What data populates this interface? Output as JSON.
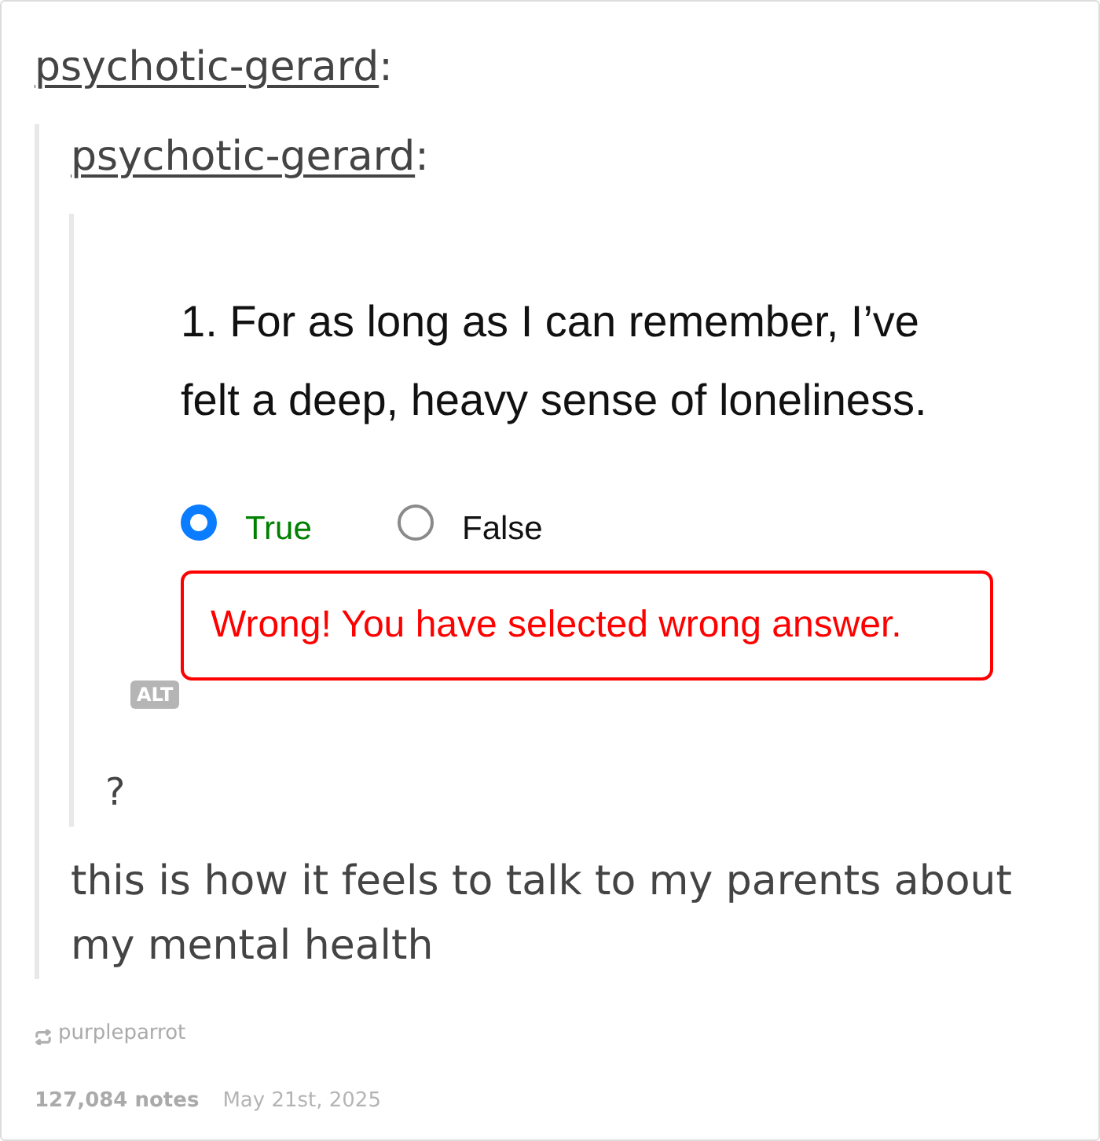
{
  "post": {
    "username": "psychotic-gerard",
    "suffix": ":",
    "quote": {
      "username": "psychotic-gerard",
      "suffix": ":",
      "quiz_image": {
        "question": "1. For as long as I can remember, I’ve felt a deep, heavy sense of loneliness.",
        "options": [
          {
            "label": "True",
            "selected": true,
            "color": "#008000"
          },
          {
            "label": "False",
            "selected": false,
            "color": "#111111"
          }
        ],
        "feedback": {
          "kind": "error",
          "text": "Wrong! You have selected wrong answer."
        },
        "alt_badge": "ALT"
      },
      "caption": "?"
    },
    "comment": "this is how it feels to talk to my parents about my mental health"
  },
  "footer": {
    "source": "purpleparrot",
    "notes": "127,084 notes",
    "date": "May 21st, 2025"
  }
}
